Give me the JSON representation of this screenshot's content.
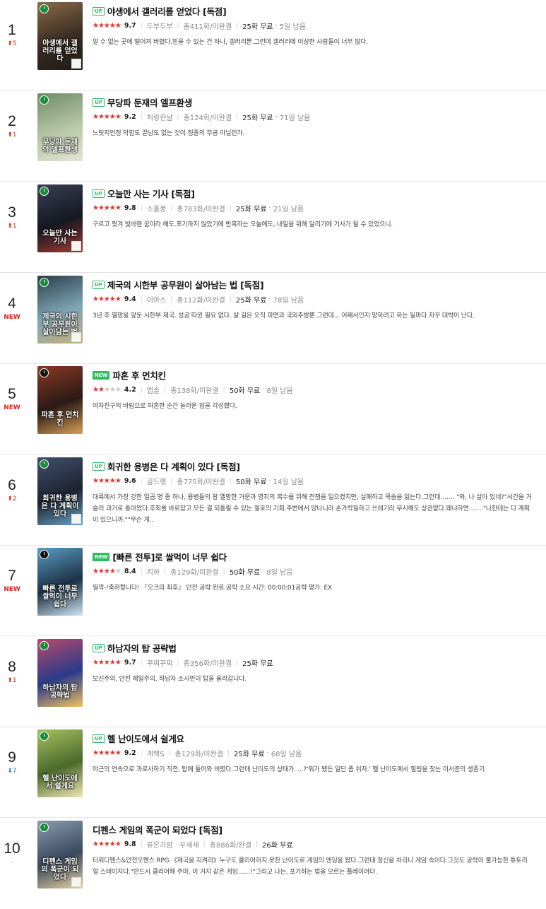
{
  "items": [
    {
      "rank": "1",
      "change": "5",
      "change_type": "up",
      "badge": "UP",
      "title": "야생에서 갤러리를 얻었다 [독점]",
      "stars": 5,
      "score": "9.7",
      "author": "두부두부",
      "episodes": "총411화/미완결",
      "free": "25화 무료",
      "remain": "5일 남음",
      "desc": "알 수 없는 곳에 떨어져 버렸다.믿을 수 있는 건 하나, 갤러리뿐.그런데 갤러리에 이상한 사람들이 너무 많다.",
      "cover_text": "야생에서 갤러리를 얻었다",
      "colors": [
        "#3a2c22",
        "#8a6a48",
        "#1e1a18"
      ]
    },
    {
      "rank": "2",
      "change": "1",
      "change_type": "up",
      "badge": "UP",
      "title": "무당파 둔재의 엘프환생",
      "stars": 4.5,
      "score": "9.2",
      "author": "처랑한날",
      "episodes": "총124화/미완결",
      "free": "25화 무료",
      "remain": "71일 남음",
      "desc": "느릿지언정 막힘도 끝남도 없는 것이 정종의 무공 아닐런가.",
      "cover_text": "무당파 둔재의 엘프환생",
      "colors": [
        "#b7c7a8",
        "#6e8a66",
        "#e5e3d2"
      ]
    },
    {
      "rank": "3",
      "change": "1",
      "change_type": "up",
      "badge": "UP",
      "title": "오늘만 사는 기사 [독점]",
      "stars": 5,
      "score": "9.8",
      "author": "소울풍",
      "episodes": "총783화/미완결",
      "free": "25화 무료",
      "remain": "21일 남음",
      "desc": "구르고 찢겨 빛바랜 꿈이라 해도.포기하지 않았기에 반복하는 오늘에도, 내일을 위해 달리기에 기사가 될 수 있었으니.",
      "cover_text": "오늘만 사는 기사",
      "colors": [
        "#151821",
        "#3a3f55",
        "#a33a34"
      ]
    },
    {
      "rank": "4",
      "change": "NEW",
      "change_type": "new",
      "badge": "UP",
      "title": "제국의 시한부 공무원이 살아남는 법 [독점]",
      "stars": 4.5,
      "score": "9.4",
      "author": "이아스",
      "episodes": "총112화/미완결",
      "free": "25화 무료",
      "remain": "78일 남음",
      "desc": "3년 후 멸망을 앞둔 시한부 제국. 성공 따윈 필요 없다. 살 길은 오직 파면과 국외추방뿐.그런데... 어째서인지 망하려고 하는 일마다 자꾸 대박이 난다.",
      "cover_text": "제국의 시한부 공무원이 살아남는 법",
      "colors": [
        "#7fa6b8",
        "#2c3e4a",
        "#c9b078"
      ]
    },
    {
      "rank": "5",
      "change": "NEW",
      "change_type": "new",
      "badge": "NEW",
      "title": "파혼 후 먼치킨",
      "stars": 2,
      "score": "4.2",
      "author": "엡솔",
      "episodes": "총138화/미완결",
      "free": "50화 무료",
      "remain": "8일 남음",
      "desc": "여자친구의 바람으로 파혼한 순간 놀라운 힘을 각성했다.",
      "cover_text": "파혼 후 먼치킨",
      "colors": [
        "#2a1a16",
        "#8a3a22",
        "#d6a058"
      ]
    },
    {
      "rank": "6",
      "change": "2",
      "change_type": "up",
      "badge": "UP",
      "title": "회귀한 용병은 다 계획이 있다 [독점]",
      "stars": 5,
      "score": "9.6",
      "author": "골드행",
      "episodes": "총775화/미완결",
      "free": "50화 무료",
      "remain": "14일 남음",
      "desc": "대륙에서 가장 강한 일곱 명 중 하나, 용병들의 왕 옐망한 가문과 영지의 복수를 위해 전쟁을 일으켰지만, 실패하고 목숨을 잃는다.그런데……. \"와, 나 살아 있네?\"시간을 거슬러 과거로 돌아왔다.후회를 바로잡고 모든 걸 되돌릴 수 있는 절호의 기회.주변에서 망나니라 손가락질하고 쓰레기라 무시해도 상관없다.왜냐하면…….\"나한테는 다 계획이 있으니까.\"\"무슨 계..",
      "cover_text": "회귀한 용병은 다 계획이 있다",
      "colors": [
        "#1d2230",
        "#41506e",
        "#6aa6c8"
      ]
    },
    {
      "rank": "7",
      "change": "NEW",
      "change_type": "new",
      "badge": "NEW",
      "title": "[빠른 전투]로 쌀먹이 너무 쉽다",
      "stars": 4,
      "score": "8.4",
      "author": "지하",
      "episodes": "총129화/미완결",
      "free": "50화 무료",
      "remain": "8일 남음",
      "desc": "띨깍-!축하합니다! 『오크의 최후』 던전 공략 완료.공략 소요 시간: 00:00:01공략 평가: EX",
      "cover_text": "빠른 전투로 쌀먹이 너무 쉽다",
      "colors": [
        "#1c3146",
        "#5a9cc4",
        "#cfe6f0"
      ]
    },
    {
      "rank": "8",
      "change": "1",
      "change_type": "up",
      "badge": "UP",
      "title": "하남자의 탑 공략법",
      "stars": 5,
      "score": "9.7",
      "author": "꾸찌꾸찌",
      "episodes": "총356화/미완결",
      "free": "25화 무료",
      "remain": "",
      "desc": "보신주의, 안전 제일주의, 하남자 소시민이 탑을 올라갑니다.",
      "cover_text": "하남자의 탑 공략법",
      "colors": [
        "#2a3b8a",
        "#b84a6a",
        "#f0c060"
      ]
    },
    {
      "rank": "9",
      "change": "7",
      "change_type": "down",
      "badge": "UP",
      "title": "헬 난이도에서 쉴게요",
      "stars": 4.5,
      "score": "9.2",
      "author": "개백S",
      "episodes": "총129화/미완결",
      "free": "25화 무료",
      "remain": "68일 남음",
      "desc": "야근의 연속으로 과로사하기 직전, 탑에 들어와 버렸다.그런데 난이도의 상태가.....?'뭐가 됐든 일단 좀 쉬자.' 헬 난이도에서 힐링을 찾는 이서준의 생존기",
      "cover_text": "헬 난이도에서 쉴게요",
      "colors": [
        "#4a6a2a",
        "#a8c060",
        "#f2e6b8"
      ]
    },
    {
      "rank": "10",
      "change": "–",
      "change_type": "same",
      "badge": "",
      "title": "디펜스 게임의 폭군이 되었다 [독점]",
      "stars": 5,
      "score": "9.8",
      "author": "류은가람 · 우새새",
      "episodes": "총886화/완결",
      "free": "26화 무료",
      "remain": "",
      "desc": "타워디펜스&던전오펜스 RPG 《제국을 지켜라》누구도 클리어하지 못한 난이도로 게임의 엔딩을 봤다.그런데 정신을 차리니 게임 속이다.그것도 공략이 불가능한 튜토리얼 스테이지다.\"반드시 클리어해 주마, 이 거지 같은 게임……!\"그리고 나는, 포기하는 법을 모르는 플레이어다.",
      "cover_text": "디펜스 게임의 폭군이 되었다",
      "colors": [
        "#3a4a5e",
        "#8a9ab0",
        "#e8d0a0"
      ]
    }
  ]
}
